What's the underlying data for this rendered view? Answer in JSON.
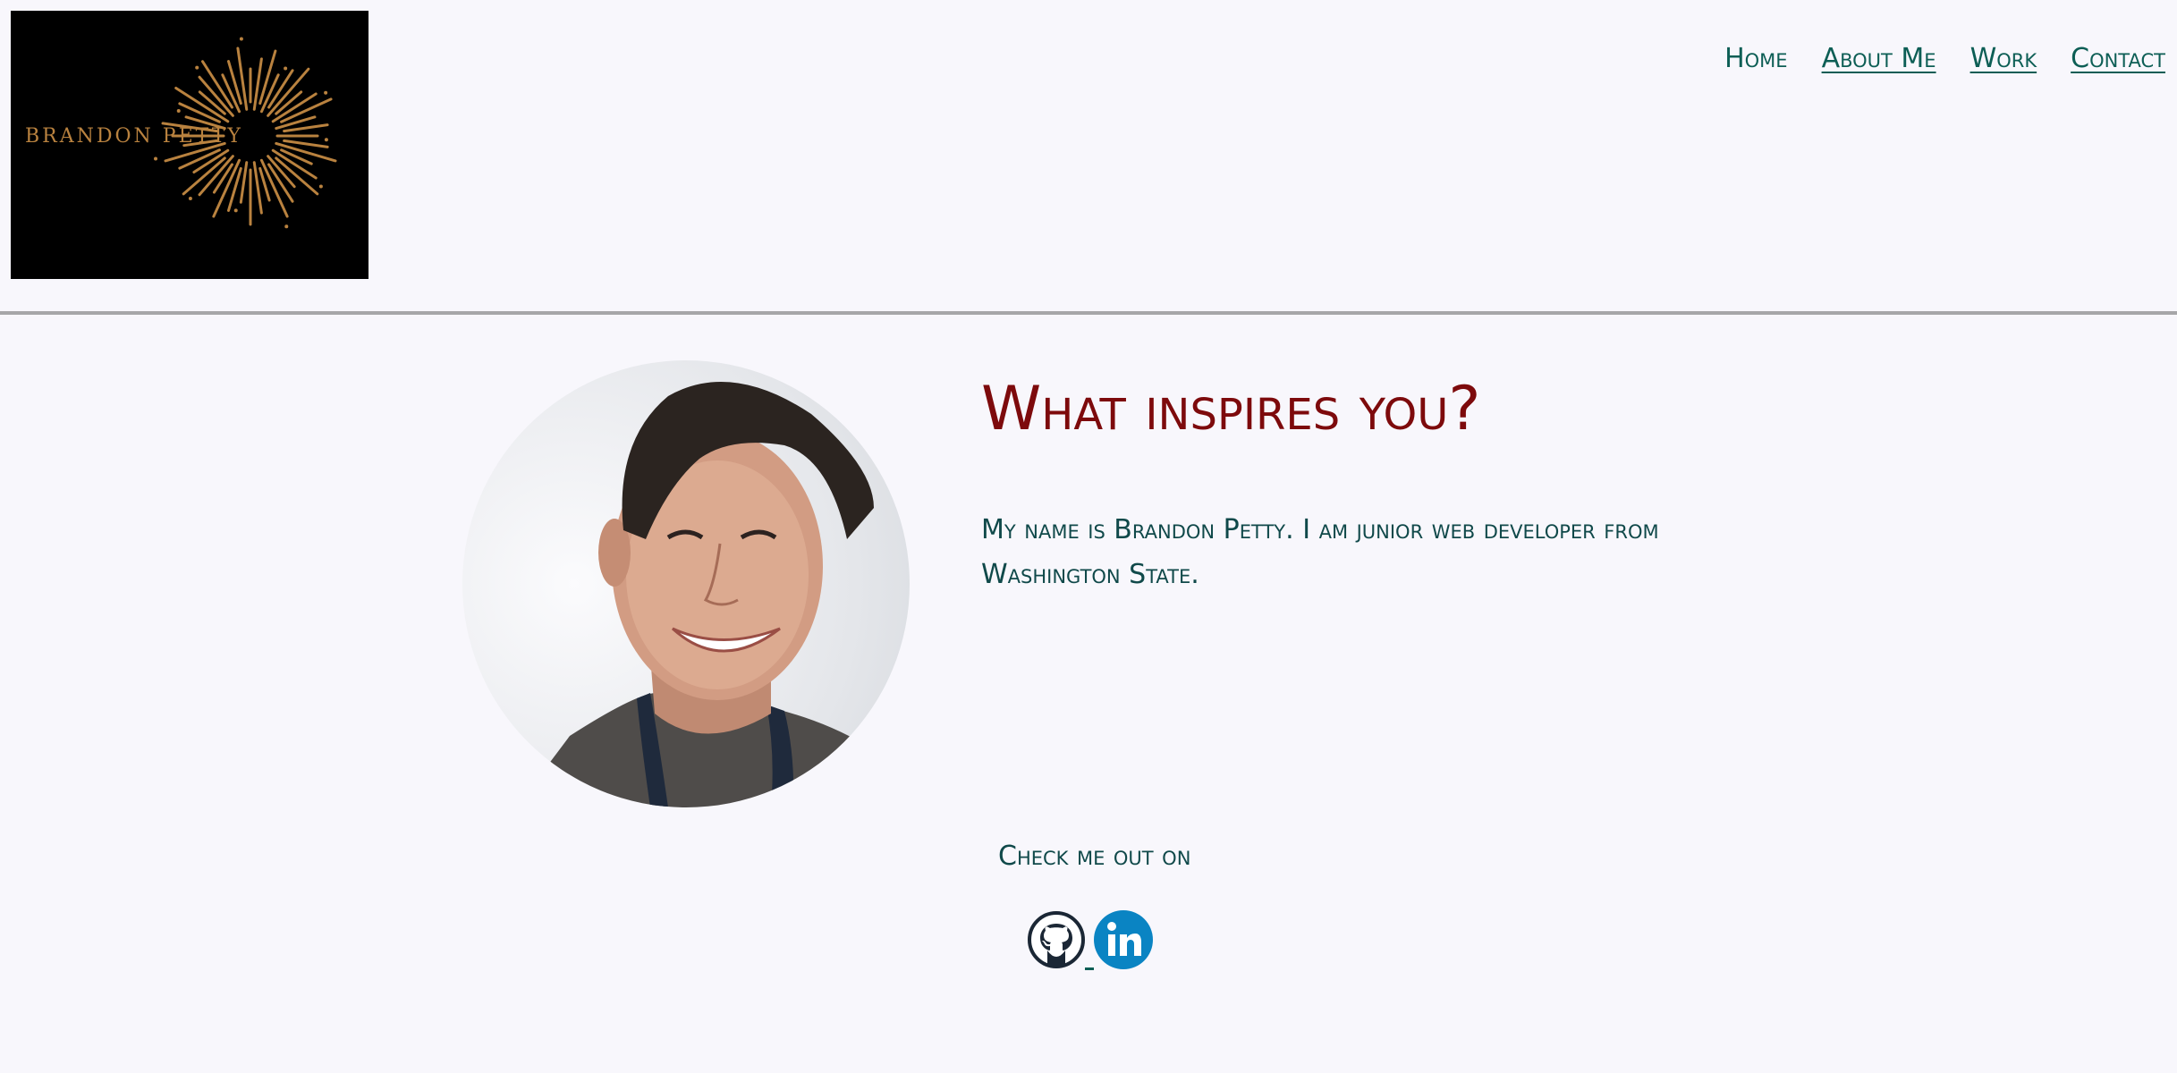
{
  "header": {
    "logo_text": "BRANDON PETTY",
    "nav": [
      {
        "label": "Home"
      },
      {
        "label": "About Me"
      },
      {
        "label": "Work"
      },
      {
        "label": "Contact"
      }
    ]
  },
  "main": {
    "headline": "What inspires you?",
    "bio": "My name is Brandon Petty. I am junior web developer from Washington State.",
    "check_me_out": "Check me out on"
  },
  "socials": [
    {
      "icon": "github-icon"
    },
    {
      "icon": "linkedin-icon"
    }
  ],
  "colors": {
    "background": "#f8f7fc",
    "nav_link": "#0d5e55",
    "headline": "#7d0a0c",
    "body_text": "#10494a",
    "logo_gold": "#b9823f",
    "divider": "#a6a6a8",
    "linkedin_blue": "#0a84c3",
    "github_dark": "#1b2735"
  }
}
